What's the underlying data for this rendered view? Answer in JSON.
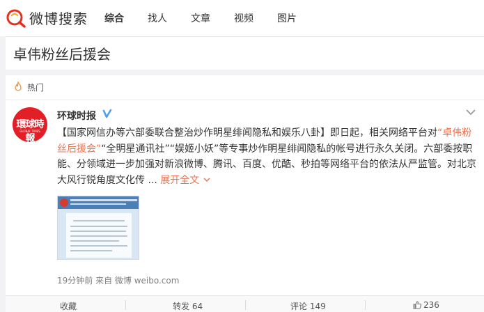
{
  "header": {
    "logo_text": "微博搜索",
    "nav": [
      {
        "label": "综合",
        "active": true
      },
      {
        "label": "找人",
        "active": false
      },
      {
        "label": "文章",
        "active": false
      },
      {
        "label": "视频",
        "active": false
      },
      {
        "label": "图片",
        "active": false
      }
    ]
  },
  "search": {
    "value": "卓伟粉丝后援会"
  },
  "hotbar": {
    "label": "热门",
    "icon": "flame-icon"
  },
  "post": {
    "author": "环球时报",
    "avatar_text": "環球時報",
    "avatar_sub": "GLOBAL TIMES",
    "verified_icon": "verified-v-icon",
    "text_prefix": "【国家网信办等六部委联合整治炒作明星绯闻隐私和娱乐八卦】即日起，相关网络平台对",
    "highlight": "“卓伟粉丝后援会”",
    "text_mid": "“全明星通讯社”“娱姬小妖”等专事炒作明星绯闻隐私的帐号进行永久关闭。六部委按职能、分领域进一步加强对新浪微博、腾讯、百度、优酷、秒拍等网络平台的依法从严监管。对北京大风行锐角度文化传 ...",
    "expand_label": "展开全文",
    "meta": "19分钟前 来自 微博 weibo.com"
  },
  "actions": {
    "collect": "收藏",
    "repost": "转发 64",
    "comment": "评论 149",
    "like": "236"
  },
  "colors": {
    "accent": "#eb7350",
    "background": "#f2f2f5",
    "avatar_red": "#e21f26",
    "verified_blue": "#4f9fe8"
  }
}
